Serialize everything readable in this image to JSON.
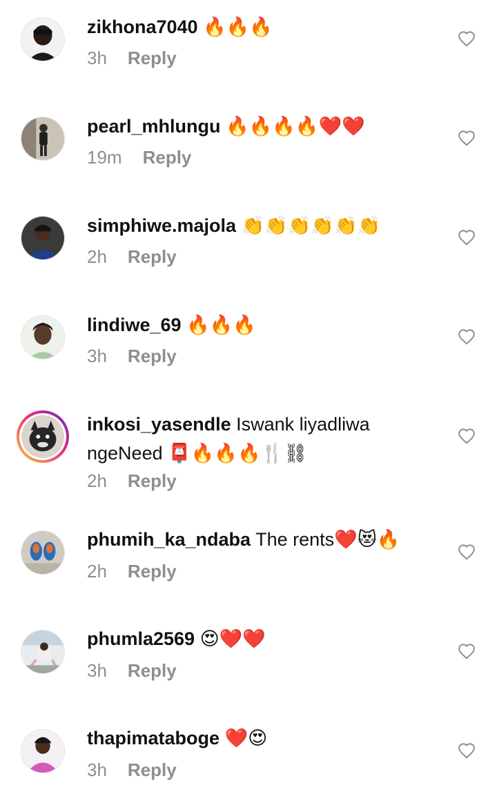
{
  "reply_label": "Reply",
  "colors": {
    "text": "#111111",
    "muted": "#8e8e8e",
    "story_ring": [
      "#f9ce34",
      "#ee2a7b",
      "#6228d7"
    ]
  },
  "comments": [
    {
      "username": "zikhona7040",
      "text": " 🔥🔥🔥",
      "time": "3h"
    },
    {
      "username": "pearl_mhlungu",
      "text": " 🔥🔥🔥🔥❤️❤️",
      "time": "19m"
    },
    {
      "username": "simphiwe.majola",
      "text": " 👏👏👏👏👏👏",
      "time": "2h"
    },
    {
      "username": "lindiwe_69",
      "text": " 🔥🔥🔥",
      "time": "3h"
    },
    {
      "username": "inkosi_yasendle",
      "text": " Iswank liyadliwa ngeNeed 📮🔥🔥🔥🍴⛓",
      "time": "2h"
    },
    {
      "username": "phumih_ka_ndaba",
      "text": " The rents❤️😻🔥",
      "time": "2h"
    },
    {
      "username": "phumla2569",
      "text": " 😍❤️❤️",
      "time": "3h"
    },
    {
      "username": "thapimataboge",
      "text": " ❤️😍",
      "time": "3h"
    }
  ]
}
